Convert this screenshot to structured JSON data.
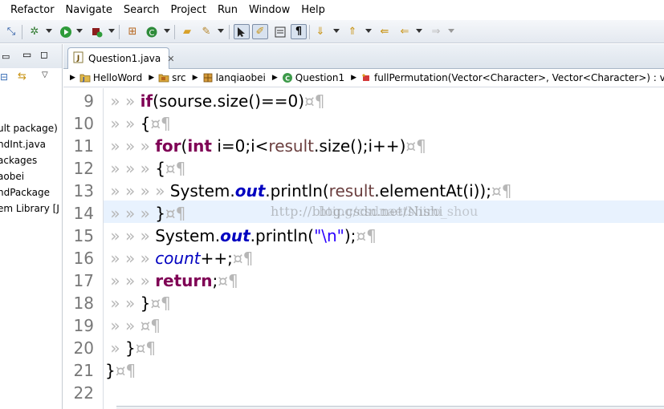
{
  "menu": [
    "Refactor",
    "Navigate",
    "Search",
    "Project",
    "Run",
    "Window",
    "Help"
  ],
  "toolbar_icons": [
    "link-icon",
    "debug-icon",
    "run-icon",
    "external-tools-icon",
    "new-java-class-icon",
    "open-type-icon",
    "folder-open-icon",
    "search-icon",
    "toggle-mark-occurrences-icon",
    "edit-icon",
    "block-selection-icon",
    "show-whitespace-icon",
    "next-annotation-icon",
    "previous-annotation-icon",
    "last-edit-location-icon",
    "back-icon",
    "forward-icon"
  ],
  "left_panel": {
    "tree_items": [
      "ult package)",
      "ndInt.java",
      "ackages",
      "aobei",
      "ndPackage",
      "em Library [J"
    ]
  },
  "editor": {
    "tab_label": "Question1.java",
    "tab_close": "✕"
  },
  "breadcrumb": [
    {
      "icon": "project-icon",
      "label": "HelloWord"
    },
    {
      "icon": "source-folder-icon",
      "label": "src"
    },
    {
      "icon": "package-icon",
      "label": "lanqiaobei"
    },
    {
      "icon": "class-icon",
      "label": "Question1"
    },
    {
      "icon": "method-icon",
      "label": "fullPermutation(Vector<Character>, Vector<Character>) : v"
    }
  ],
  "line_numbers": [
    "9",
    "10",
    "11",
    "12",
    "13",
    "14",
    "15",
    "16",
    "17",
    "18",
    "19",
    "20",
    "21",
    "22"
  ],
  "code": {
    "l9_kw": "if",
    "l9_rest": "(sourse.size()==0)",
    "l10": "{",
    "l11_kw": "for",
    "l11_a": "(",
    "l11_kw2": "int",
    "l11_rest": " i=0;i<",
    "l11_var": "result",
    "l11_end": ".size();i++)",
    "l12": "{",
    "l13_a": "System.",
    "l13_out": "out",
    "l13_b": ".println(",
    "l13_var": "result",
    "l13_c": ".elementAt(i));",
    "l14": "}",
    "l15_a": "System.",
    "l15_out": "out",
    "l15_b": ".println(",
    "l15_str": "\"\\n\"",
    "l15_c": ");",
    "l16_fld": "count",
    "l16_rest": "++;",
    "l17_kw": "return",
    "l17_rest": ";",
    "l18": "}",
    "l20": "}",
    "l21": "}",
    "whitespace_mark": "¤¶",
    "tab_mark": "»",
    "space_mark": "·"
  },
  "watermark_1": "http://blog.csdn.net/Nishi",
  "watermark_2": "htipg/csdnaetshiro_shou"
}
